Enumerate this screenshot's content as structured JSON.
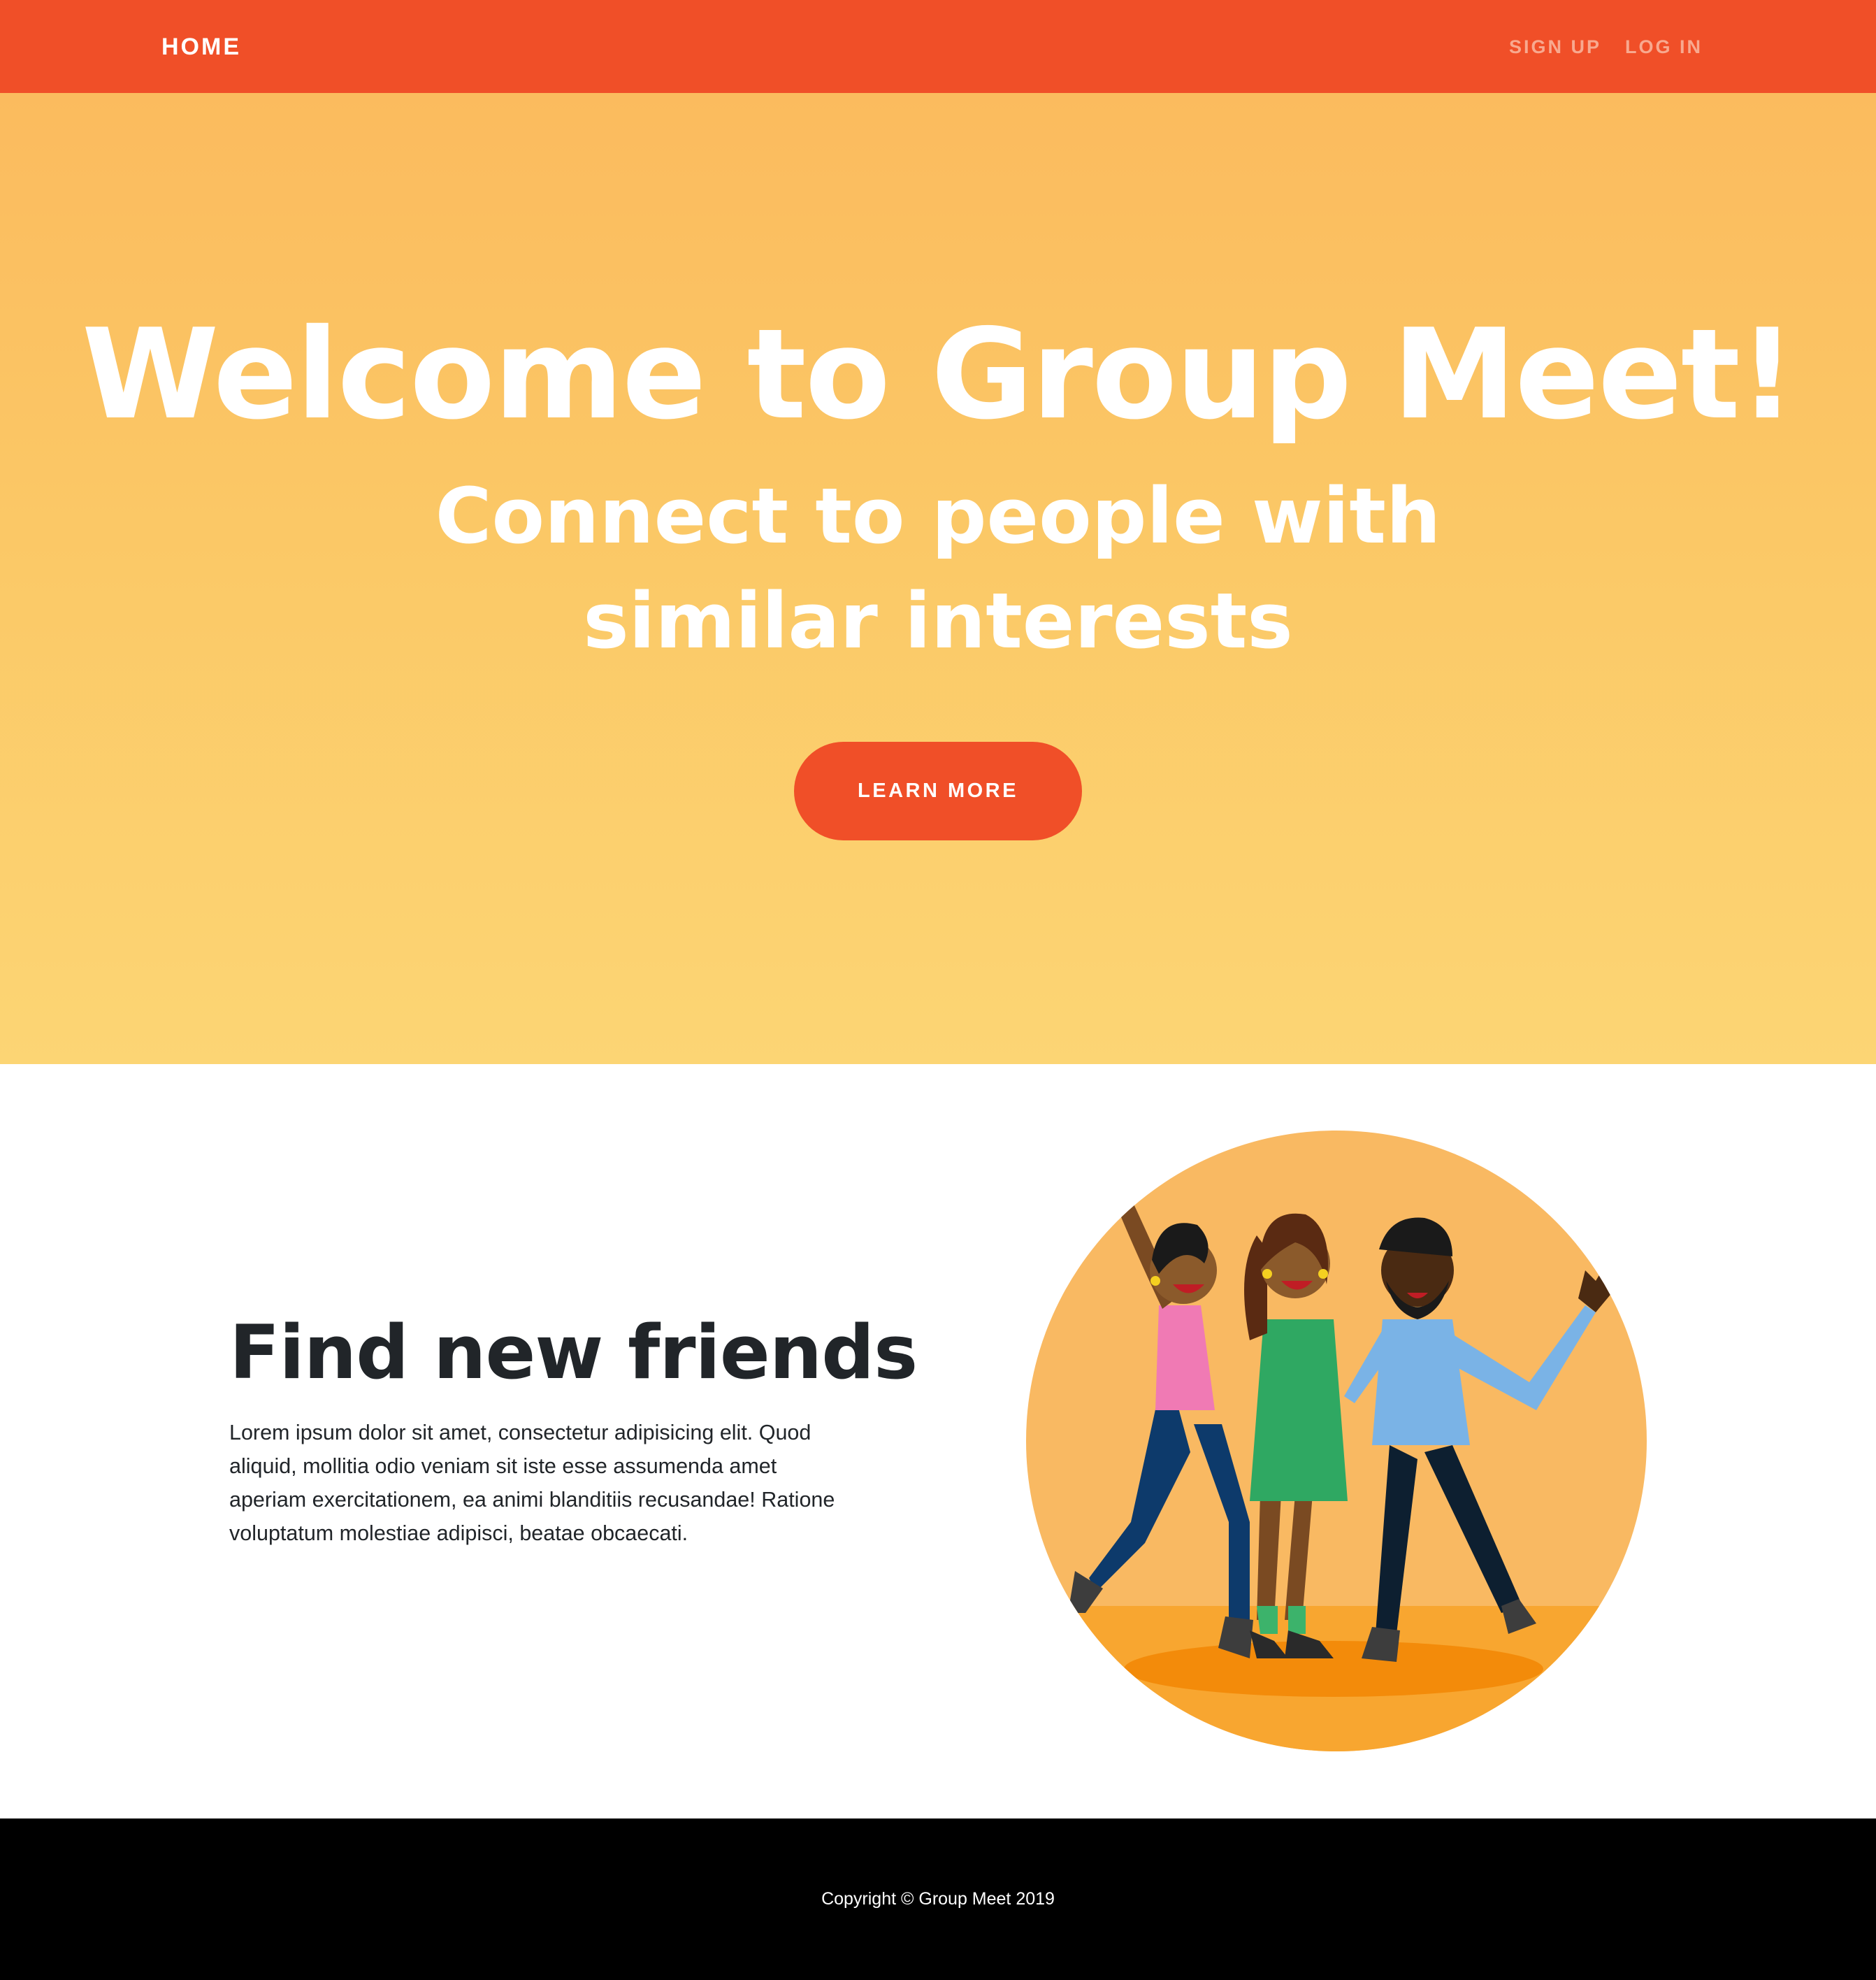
{
  "navbar": {
    "home_label": "HOME",
    "links": [
      {
        "label": "SIGN UP"
      },
      {
        "label": "LOG IN"
      }
    ],
    "background_color": "#f04f28"
  },
  "hero": {
    "title": "Welcome to Group Meet!",
    "subtitle": "Connect to people with similar interests",
    "cta_label": "LEARN MORE",
    "gradient_top": "#fbbb5e",
    "gradient_bottom": "#fcd574"
  },
  "feature": {
    "heading": "Find new friends",
    "body": "Lorem ipsum dolor sit amet, consectetur adipisicing elit. Quod aliquid, mollitia odio veniam sit iste esse assumenda amet aperiam exercitationem, ea animi blanditiis recusandae! Ratione voluptatum molestiae adipisci, beatae obcaecati.",
    "image": "three-friends-celebrating-illustration"
  },
  "footer": {
    "copyright": "Copyright © Group Meet 2019"
  }
}
